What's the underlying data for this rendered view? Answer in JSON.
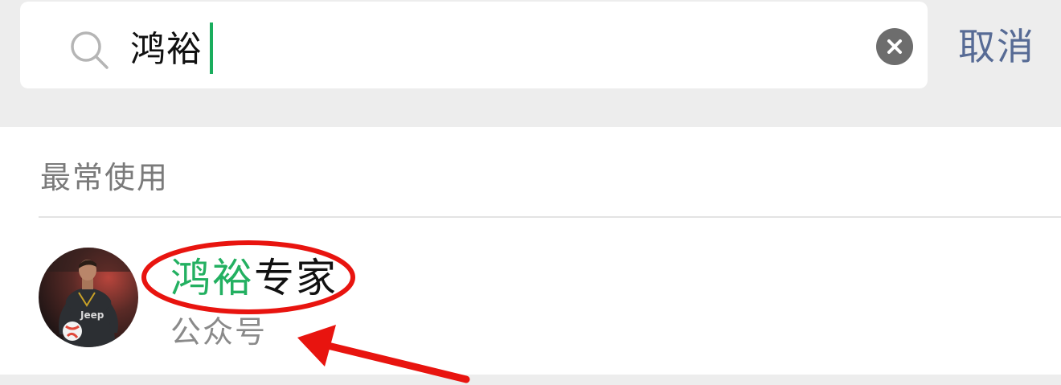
{
  "search": {
    "query": "鸿裕",
    "cancel_label": "取消"
  },
  "results": {
    "section_title": "最常使用",
    "items": [
      {
        "name_highlight": "鸿裕",
        "name_rest": "专家",
        "type": "公众号",
        "avatar": "soccer-player-avatar"
      }
    ]
  },
  "colors": {
    "highlight": "#23b061",
    "cancel": "#576b95",
    "caret": "#1aad5d",
    "annotation": "#e8140f"
  }
}
